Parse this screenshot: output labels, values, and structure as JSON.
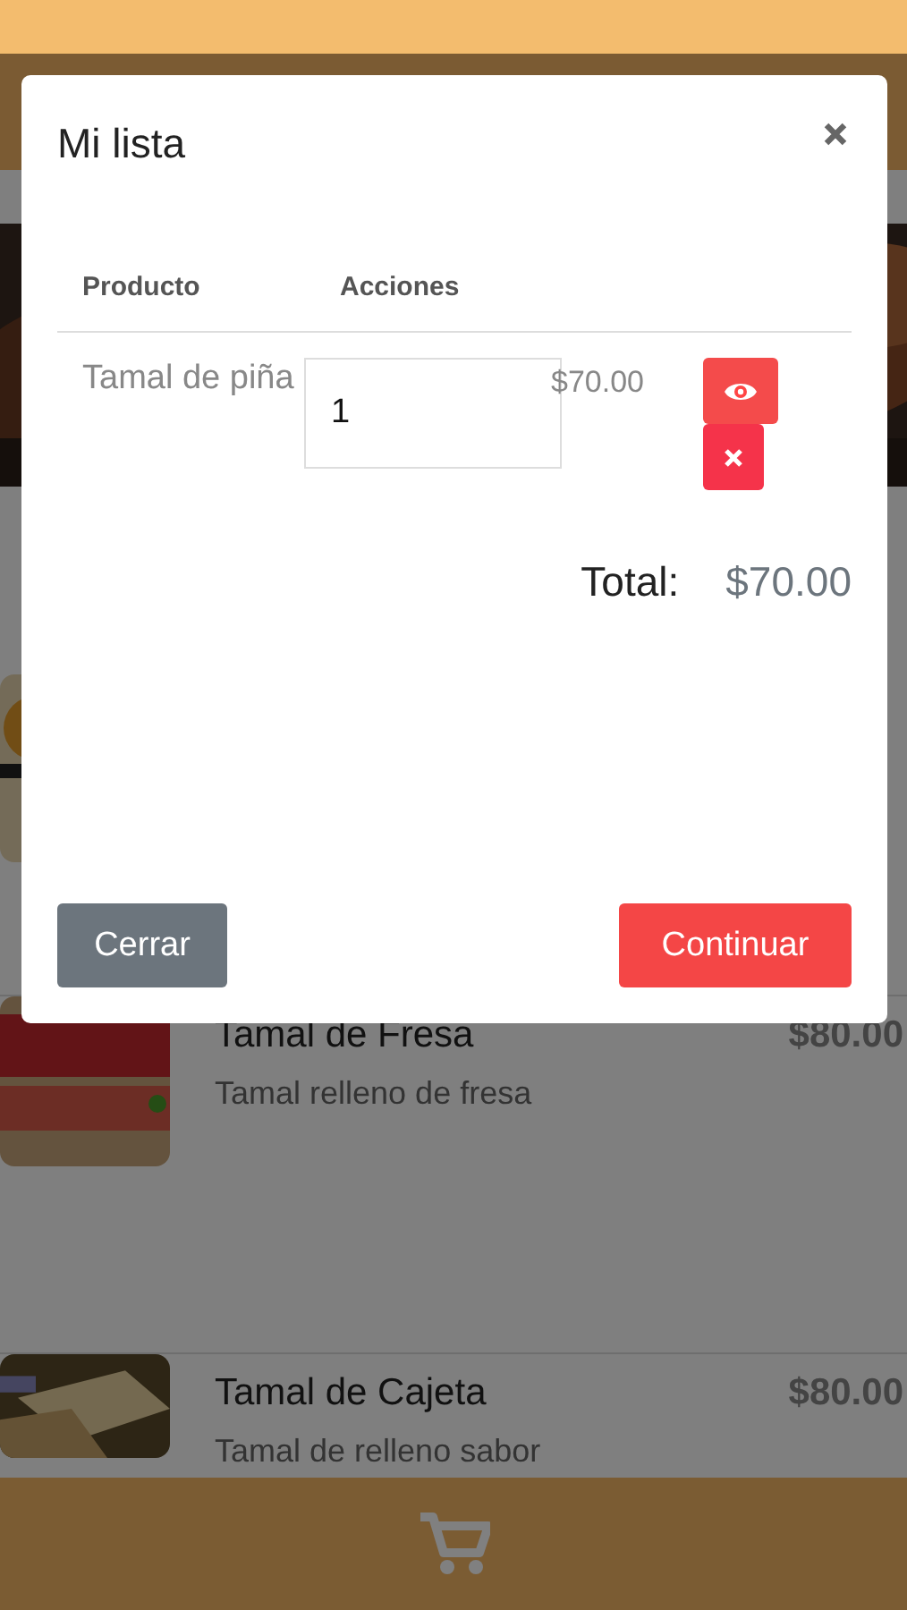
{
  "products": [
    {
      "name": "Tamal de Fresa",
      "description": "Tamal relleno de fresa",
      "price": "$80.00"
    },
    {
      "name": "Tamal de Cajeta",
      "description": "Tamal de relleno sabor",
      "price": "$80.00"
    }
  ],
  "modal": {
    "title": "Mi lista",
    "columns": [
      "Producto",
      "Acciones"
    ],
    "rows": [
      {
        "product": "Tamal de piña",
        "quantity": "1",
        "price": "$70.00"
      }
    ],
    "total_label": "Total:",
    "total": "$70.00",
    "buttons": [
      {
        "label": "Cerrar",
        "kind": "secondary"
      },
      {
        "label": "Continuar",
        "kind": "primary"
      }
    ]
  }
}
